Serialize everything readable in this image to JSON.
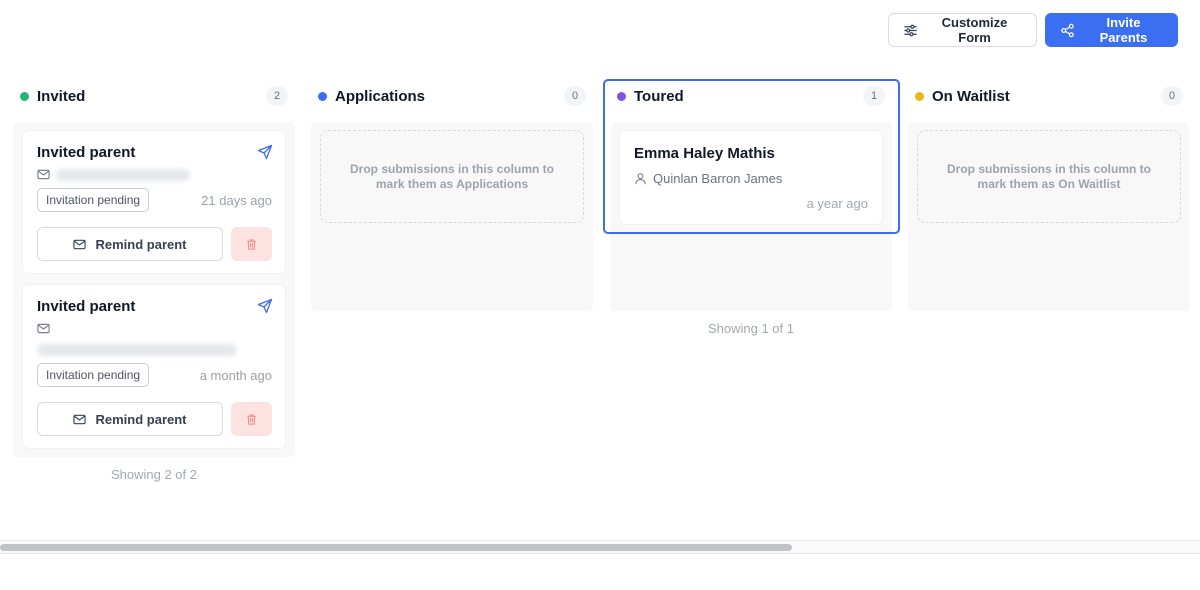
{
  "toolbar": {
    "customize_label": "Customize Form",
    "invite_label": "Invite Parents"
  },
  "colors": {
    "invited": "#22b573",
    "applications": "#3b6ef0",
    "toured": "#7a55e6",
    "waitlist": "#e8b817",
    "primary": "#3b6ef0",
    "focus": "#3a6df0"
  },
  "columns": {
    "invited": {
      "title": "Invited",
      "count": "2",
      "cards": [
        {
          "title": "Invited parent",
          "status": "Invitation pending",
          "time": "21 days ago",
          "remind_label": "Remind parent"
        },
        {
          "title": "Invited parent",
          "status": "Invitation pending",
          "time": "a month ago",
          "remind_label": "Remind parent"
        }
      ],
      "showing": "Showing 2 of 2"
    },
    "applications": {
      "title": "Applications",
      "count": "0",
      "empty_text": "Drop submissions in this column to mark them as Applications"
    },
    "toured": {
      "title": "Toured",
      "count": "1",
      "cards": [
        {
          "name": "Emma Haley Mathis",
          "parent": "Quinlan Barron James",
          "time": "a year ago"
        }
      ],
      "showing": "Showing 1 of 1"
    },
    "waitlist": {
      "title": "On Waitlist",
      "count": "0",
      "empty_text": "Drop submissions in this column to mark them as On Waitlist"
    }
  },
  "scrollbar": {
    "position_fraction": 0.66
  },
  "icons": [
    "sliders-icon",
    "share-icon",
    "send-icon",
    "mail-icon",
    "user-icon",
    "trash-icon"
  ]
}
